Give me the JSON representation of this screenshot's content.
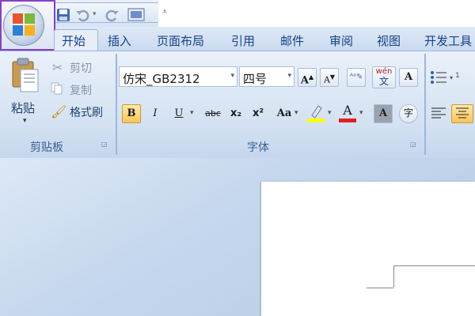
{
  "quick_access": {
    "icons": [
      "save-icon",
      "undo-icon",
      "redo-icon",
      "print-preview-icon",
      "customize-qat-icon"
    ]
  },
  "tabs": [
    {
      "label": "开始",
      "active": true
    },
    {
      "label": "插入"
    },
    {
      "label": "页面布局"
    },
    {
      "label": "引用"
    },
    {
      "label": "邮件"
    },
    {
      "label": "审阅"
    },
    {
      "label": "视图"
    },
    {
      "label": "开发工具"
    }
  ],
  "clipboard": {
    "paste_label": "粘贴",
    "cut_label": "剪切",
    "copy_label": "复制",
    "format_painter_label": "格式刷",
    "group_label": "剪贴板"
  },
  "font": {
    "font_name": "仿宋_GB2312",
    "font_size": "四号",
    "group_label": "字体",
    "buttons": {
      "bold": "B",
      "italic": "I",
      "underline": "U",
      "strike": "abc",
      "subscript": "x₂",
      "superscript": "x²",
      "change_case": "Aa",
      "grow": "A",
      "shrink": "A",
      "font_color": "A",
      "char_shade": "A",
      "enclose": "字",
      "phonetic": "wén",
      "border": "A"
    }
  },
  "colors": {
    "highlight": "#ffff00",
    "font_color": "#e02020"
  }
}
